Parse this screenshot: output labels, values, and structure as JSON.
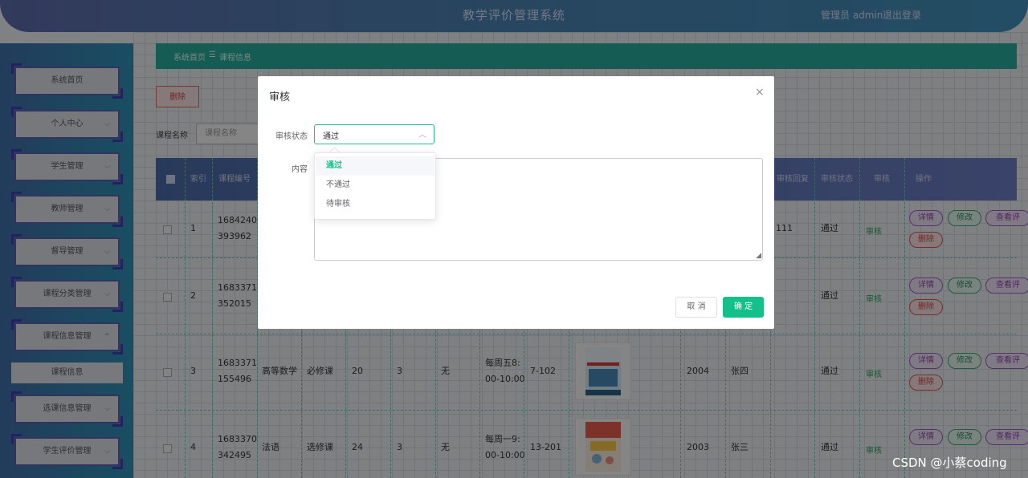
{
  "header": {
    "title": "教学评价管理系统",
    "admin": "管理员 admin",
    "logout": "退出登录"
  },
  "sidebar": {
    "items": [
      {
        "label": "系统首页",
        "chevron": ""
      },
      {
        "label": "个人中心",
        "chevron": "⌵"
      },
      {
        "label": "学生管理",
        "chevron": "⌵"
      },
      {
        "label": "教师管理",
        "chevron": "⌵"
      },
      {
        "label": "督导管理",
        "chevron": "⌵"
      },
      {
        "label": "课程分类管理",
        "chevron": "⌵"
      },
      {
        "label": "课程信息管理",
        "chevron": "^"
      },
      {
        "label": "选课信息管理",
        "chevron": "⌵"
      },
      {
        "label": "学生评价管理",
        "chevron": "⌵"
      }
    ],
    "sub_item": "课程信息"
  },
  "breadcrumb": {
    "home": "系统首页",
    "sep": "☰",
    "current": "课程信息"
  },
  "toolbar": {
    "delete_label": "删除",
    "search_label": "课程名称",
    "search_placeholder": "课程名称"
  },
  "table": {
    "headers": {
      "index": "索引",
      "code": "课程编号",
      "audit_reply": "审核回复",
      "audit_status": "审核状态",
      "audit": "审核",
      "actions": "操作"
    },
    "rows": [
      {
        "index": "1",
        "code_a": "1684240",
        "code_b": "393962",
        "name": "",
        "type": "",
        "hours": "",
        "credits": "",
        "prereq": "",
        "time_a": "",
        "time_b": "",
        "room": "",
        "year": "",
        "teacher": "",
        "reply": "111",
        "status": "通过",
        "audit": "审核"
      },
      {
        "index": "2",
        "code_a": "1683371",
        "code_b": "352015",
        "name": "",
        "type": "",
        "hours": "",
        "credits": "",
        "prereq": "",
        "time_a": "",
        "time_b": "",
        "room": "",
        "year": "",
        "teacher": "",
        "reply": "",
        "status": "通过",
        "audit": "审核"
      },
      {
        "index": "3",
        "code_a": "1683371",
        "code_b": "155496",
        "name": "高等数学",
        "type": "必修课",
        "hours": "20",
        "credits": "3",
        "prereq": "无",
        "time_a": "每周五8:",
        "time_b": "00-10:00",
        "room": "7-102",
        "year": "2004",
        "teacher": "张四",
        "reply": "",
        "status": "通过",
        "audit": "审核"
      },
      {
        "index": "4",
        "code_a": "1683370",
        "code_b": "342495",
        "name": "法语",
        "type": "选修课",
        "hours": "24",
        "credits": "3",
        "prereq": "无",
        "time_a": "每周一9:",
        "time_b": "00-10:00",
        "room": "13-201",
        "year": "2003",
        "teacher": "张三",
        "reply": "",
        "status": "通过",
        "audit": "审核"
      }
    ],
    "actions": {
      "detail": "详情",
      "edit": "修改",
      "view": "查看评",
      "delete": "删除"
    }
  },
  "dialog": {
    "title": "审核",
    "status_label": "审核状态",
    "status_value": "通过",
    "content_label": "内容",
    "options": [
      "通过",
      "不通过",
      "待审核"
    ],
    "cancel": "取 消",
    "confirm": "确 定"
  },
  "watermark": "CSDN @小蔡coding"
}
